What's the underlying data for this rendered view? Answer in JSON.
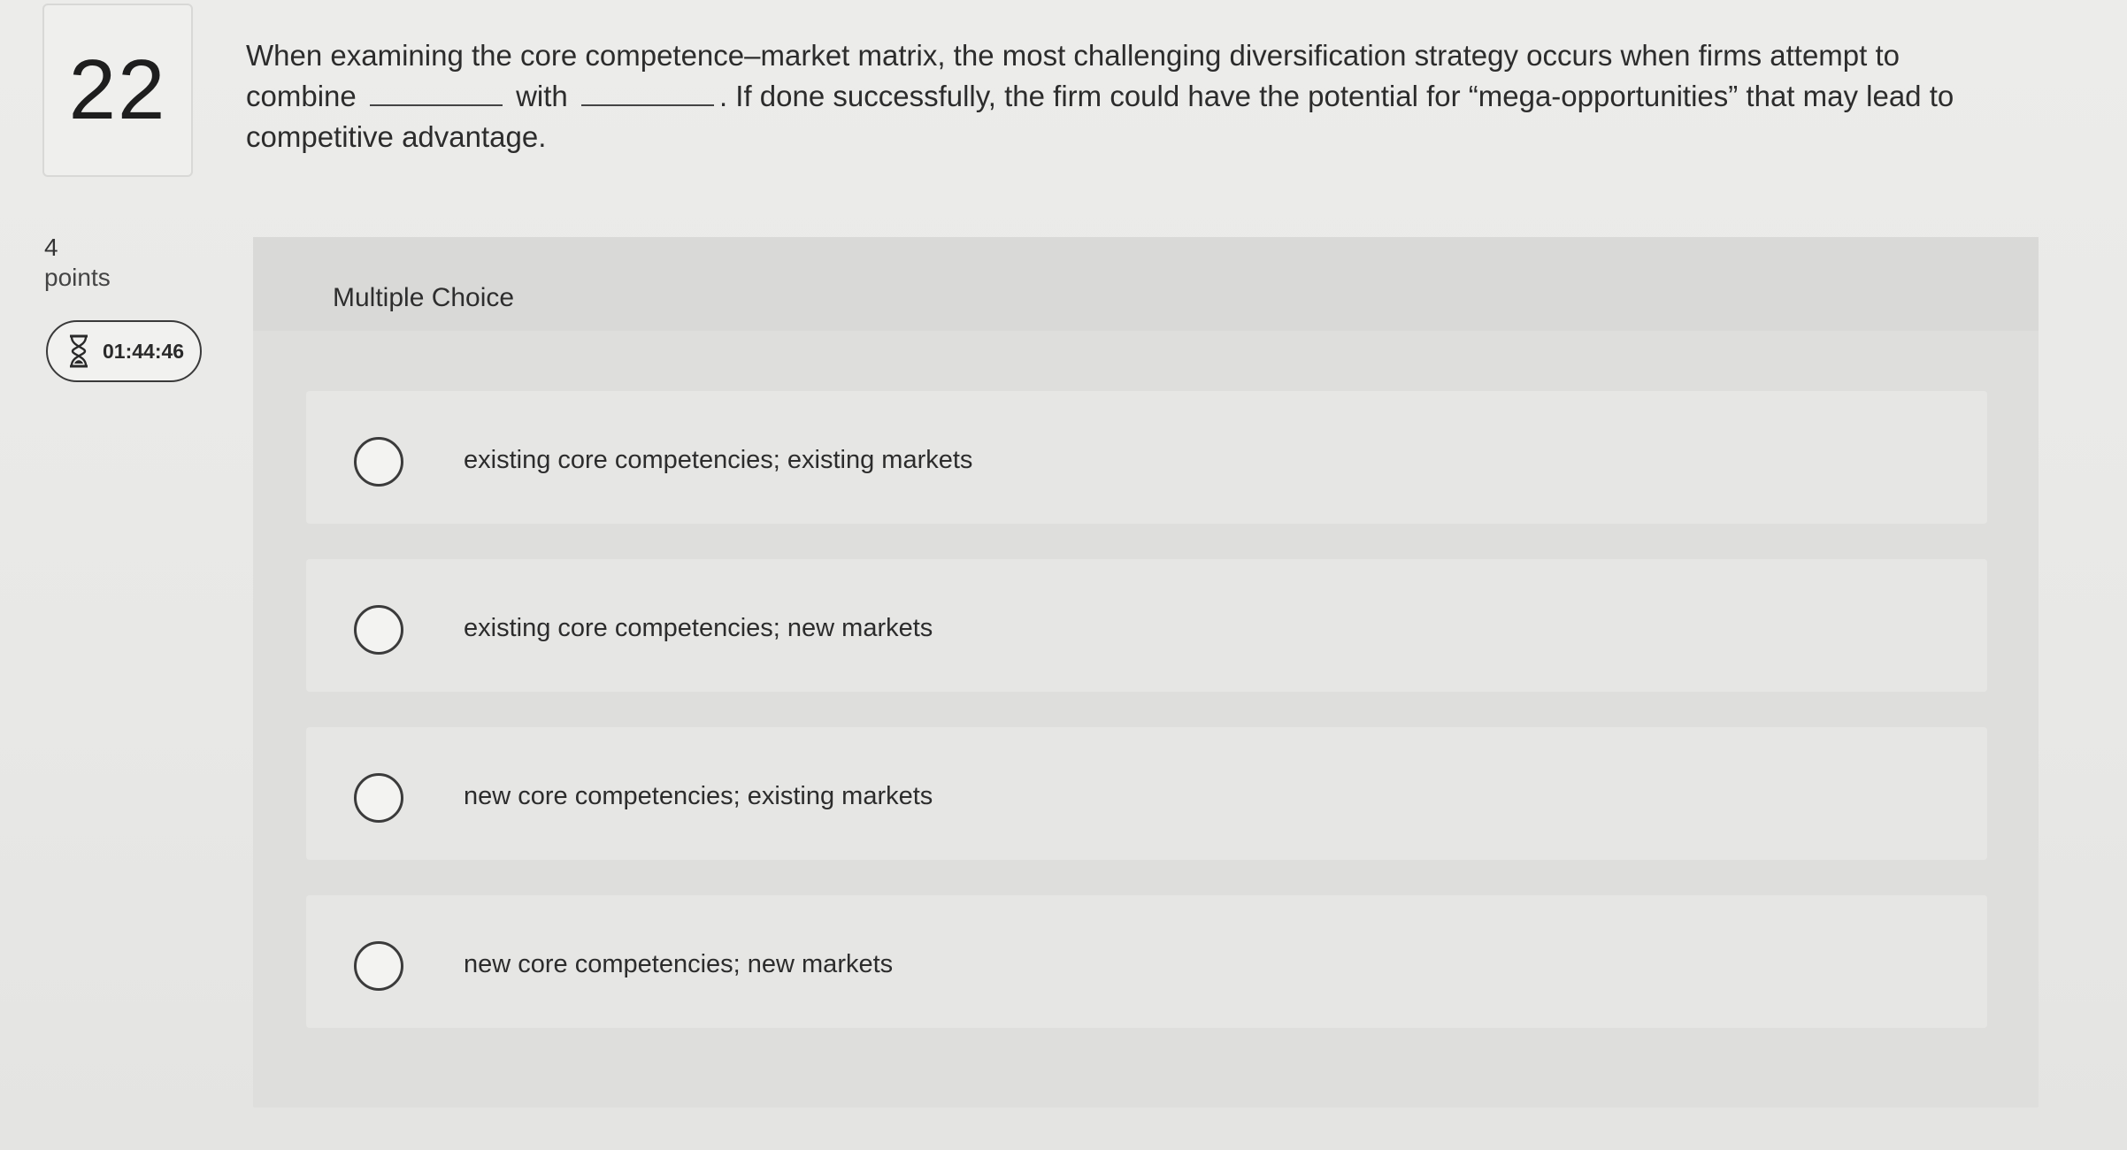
{
  "question": {
    "number": "22",
    "points_value": "4",
    "points_label": "points",
    "timer": "01:44:46",
    "text_part1": "When examining the core competence–market matrix, the most challenging diversification strategy occurs when firms attempt to combine",
    "text_part2": "with",
    "text_part3": ". If done successfully, the firm could have the potential for “mega-opportunities” that may lead to competitive advantage."
  },
  "multiple_choice": {
    "title": "Multiple Choice",
    "options": [
      {
        "label": "existing core competencies; existing markets"
      },
      {
        "label": "existing core competencies; new markets"
      },
      {
        "label": "new core competencies; existing markets"
      },
      {
        "label": "new core competencies; new markets"
      }
    ]
  },
  "icons": {
    "timer": "hourglass-icon"
  },
  "colors": {
    "background": "#e9e9e7",
    "panel": "#dededc",
    "option": "#e6e6e4",
    "text": "#2c2c2c"
  }
}
